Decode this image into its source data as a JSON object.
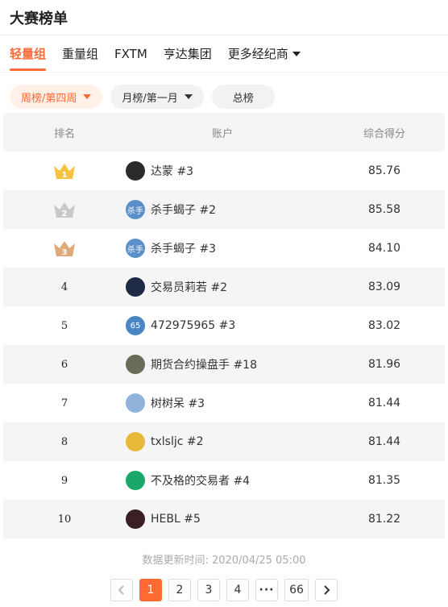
{
  "header": {
    "title": "大赛榜单"
  },
  "tabs": [
    {
      "label": "轻量组",
      "active": true
    },
    {
      "label": "重量组",
      "active": false
    },
    {
      "label": "FXTM",
      "active": false
    },
    {
      "label": "亨达集团",
      "active": false
    },
    {
      "label": "更多经纪商",
      "active": false,
      "dropdown": true
    }
  ],
  "filters": {
    "week": "周榜/第四周",
    "month": "月榜/第一月",
    "total": "总榜"
  },
  "table": {
    "headers": {
      "rank": "排名",
      "account": "账户",
      "score": "综合得分"
    },
    "rows": [
      {
        "rank": "1",
        "name": "达蒙 #3",
        "score": "85.76",
        "avatar_text": "",
        "avatar_color": "#2b2b2b"
      },
      {
        "rank": "2",
        "name": "杀手蝎子 #2",
        "score": "85.58",
        "avatar_text": "杀手",
        "avatar_color": "#5b8fc9"
      },
      {
        "rank": "3",
        "name": "杀手蝎子 #3",
        "score": "84.10",
        "avatar_text": "杀手",
        "avatar_color": "#5b8fc9"
      },
      {
        "rank": "4",
        "name": "交易员莉若 #2",
        "score": "83.09",
        "avatar_text": "",
        "avatar_color": "#1f2a44"
      },
      {
        "rank": "5",
        "name": "472975965 #3",
        "score": "83.02",
        "avatar_text": "65",
        "avatar_color": "#4a86c5"
      },
      {
        "rank": "6",
        "name": "期货合约操盘手 #18",
        "score": "81.96",
        "avatar_text": "",
        "avatar_color": "#6b6b5a"
      },
      {
        "rank": "7",
        "name": "树树呆 #3",
        "score": "81.44",
        "avatar_text": "",
        "avatar_color": "#8fb3d9"
      },
      {
        "rank": "8",
        "name": "txlsljc #2",
        "score": "81.44",
        "avatar_text": "",
        "avatar_color": "#e8b93a"
      },
      {
        "rank": "9",
        "name": "不及格的交易者 #4",
        "score": "81.35",
        "avatar_text": "",
        "avatar_color": "#1aa86a"
      },
      {
        "rank": "10",
        "name": "HEBL #5",
        "score": "81.22",
        "avatar_text": "",
        "avatar_color": "#3a1f24"
      }
    ]
  },
  "medals": {
    "gold": "#f5c242",
    "silver": "#c9c9c9",
    "bronze": "#e0a97a"
  },
  "update_text": "数据更新时间: 2020/04/25 05:00",
  "pagination": {
    "prev_icon": "chevron-left-icon",
    "pages": [
      "1",
      "2",
      "3",
      "4"
    ],
    "ellipsis": "···",
    "last": "66",
    "current": "1",
    "next_icon": "chevron-right-icon"
  },
  "accent_color": "#ff6a33"
}
